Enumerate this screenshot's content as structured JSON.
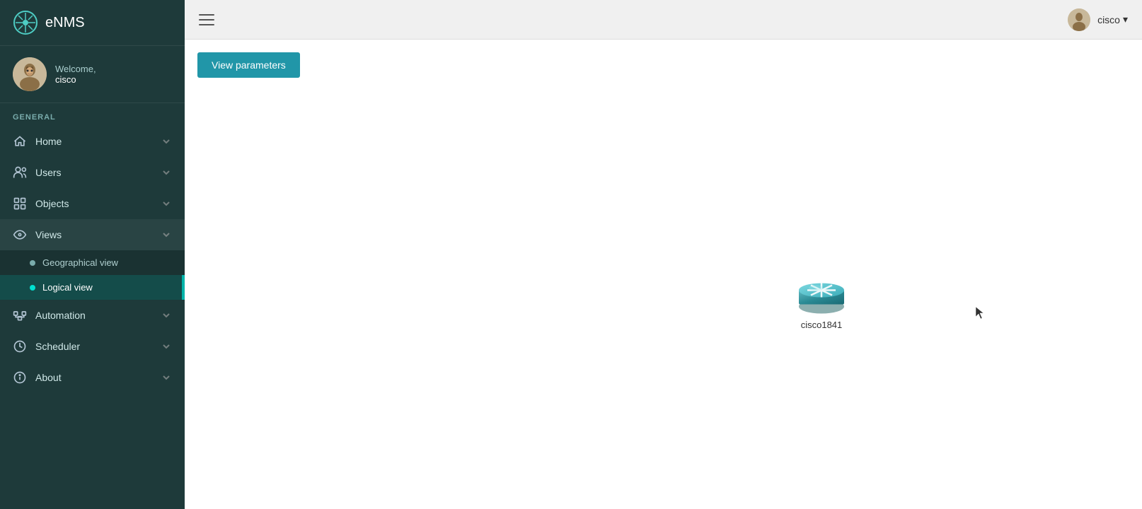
{
  "app": {
    "name": "eNMS"
  },
  "topbar": {
    "username": "cisco",
    "chevron": "▾"
  },
  "user": {
    "welcome": "Welcome,",
    "name": "cisco"
  },
  "sidebar": {
    "general_label": "GENERAL",
    "nav_items": [
      {
        "id": "home",
        "label": "Home",
        "icon": "home-icon"
      },
      {
        "id": "users",
        "label": "Users",
        "icon": "users-icon"
      },
      {
        "id": "objects",
        "label": "Objects",
        "icon": "objects-icon"
      },
      {
        "id": "views",
        "label": "Views",
        "icon": "views-icon",
        "active": true,
        "children": [
          {
            "id": "geographical-view",
            "label": "Geographical view",
            "active": false
          },
          {
            "id": "logical-view",
            "label": "Logical view",
            "active": true
          }
        ]
      },
      {
        "id": "automation",
        "label": "Automation",
        "icon": "automation-icon"
      },
      {
        "id": "scheduler",
        "label": "Scheduler",
        "icon": "scheduler-icon"
      },
      {
        "id": "about",
        "label": "About",
        "icon": "about-icon"
      }
    ]
  },
  "content": {
    "view_params_button": "View parameters",
    "device": {
      "name": "cisco1841"
    }
  }
}
